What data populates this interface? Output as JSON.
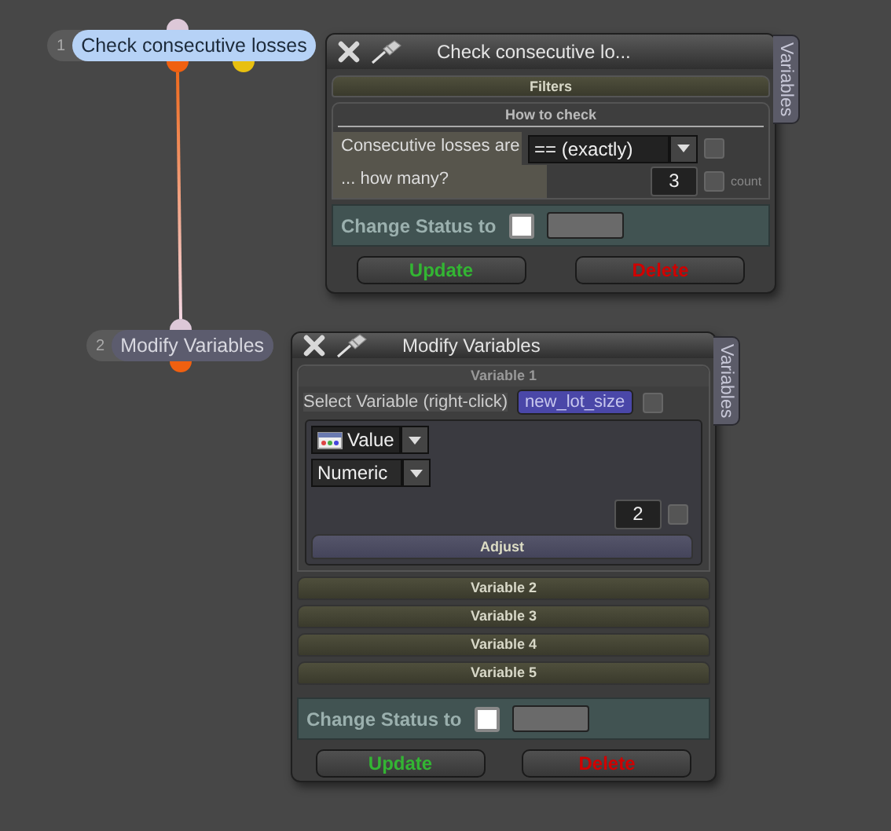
{
  "nodes": [
    {
      "number": "1",
      "label": "Check consecutive losses",
      "selected": true
    },
    {
      "number": "2",
      "label": "Modify Variables",
      "selected": false
    }
  ],
  "check_panel": {
    "title": "Check consecutive lo...",
    "side_tab": "Variables",
    "filters_header": "Filters",
    "group_header": "How to check",
    "rows": [
      {
        "kind": "dropdown",
        "label": "Consecutive losses are",
        "value": "== (exactly)",
        "checked": false
      },
      {
        "kind": "number",
        "label": "... how many?",
        "value": "3",
        "checked": false,
        "suffix": "count"
      }
    ],
    "status": {
      "label": "Change Status to",
      "checked": false
    },
    "buttons": [
      {
        "kind": "update",
        "label": "Update"
      },
      {
        "kind": "delete",
        "label": "Delete"
      }
    ]
  },
  "variables_panel": {
    "title": "Modify Variables",
    "side_tab": "Variables",
    "variables": [
      {
        "header": "Variable 1",
        "expanded": true,
        "select_label": "Select Variable (right-click)",
        "variable": "new_lot_size",
        "variable_checked": false,
        "source": "Value",
        "type": "Numeric",
        "value": "2",
        "checked": false,
        "adjust": "Adjust"
      },
      {
        "header": "Variable 2",
        "expanded": false
      },
      {
        "header": "Variable 3",
        "expanded": false
      },
      {
        "header": "Variable 4",
        "expanded": false
      },
      {
        "header": "Variable 5",
        "expanded": false
      }
    ],
    "status": {
      "label": "Change Status to",
      "checked": false
    },
    "buttons": [
      {
        "kind": "update",
        "label": "Update"
      },
      {
        "kind": "delete",
        "label": "Delete"
      }
    ]
  }
}
